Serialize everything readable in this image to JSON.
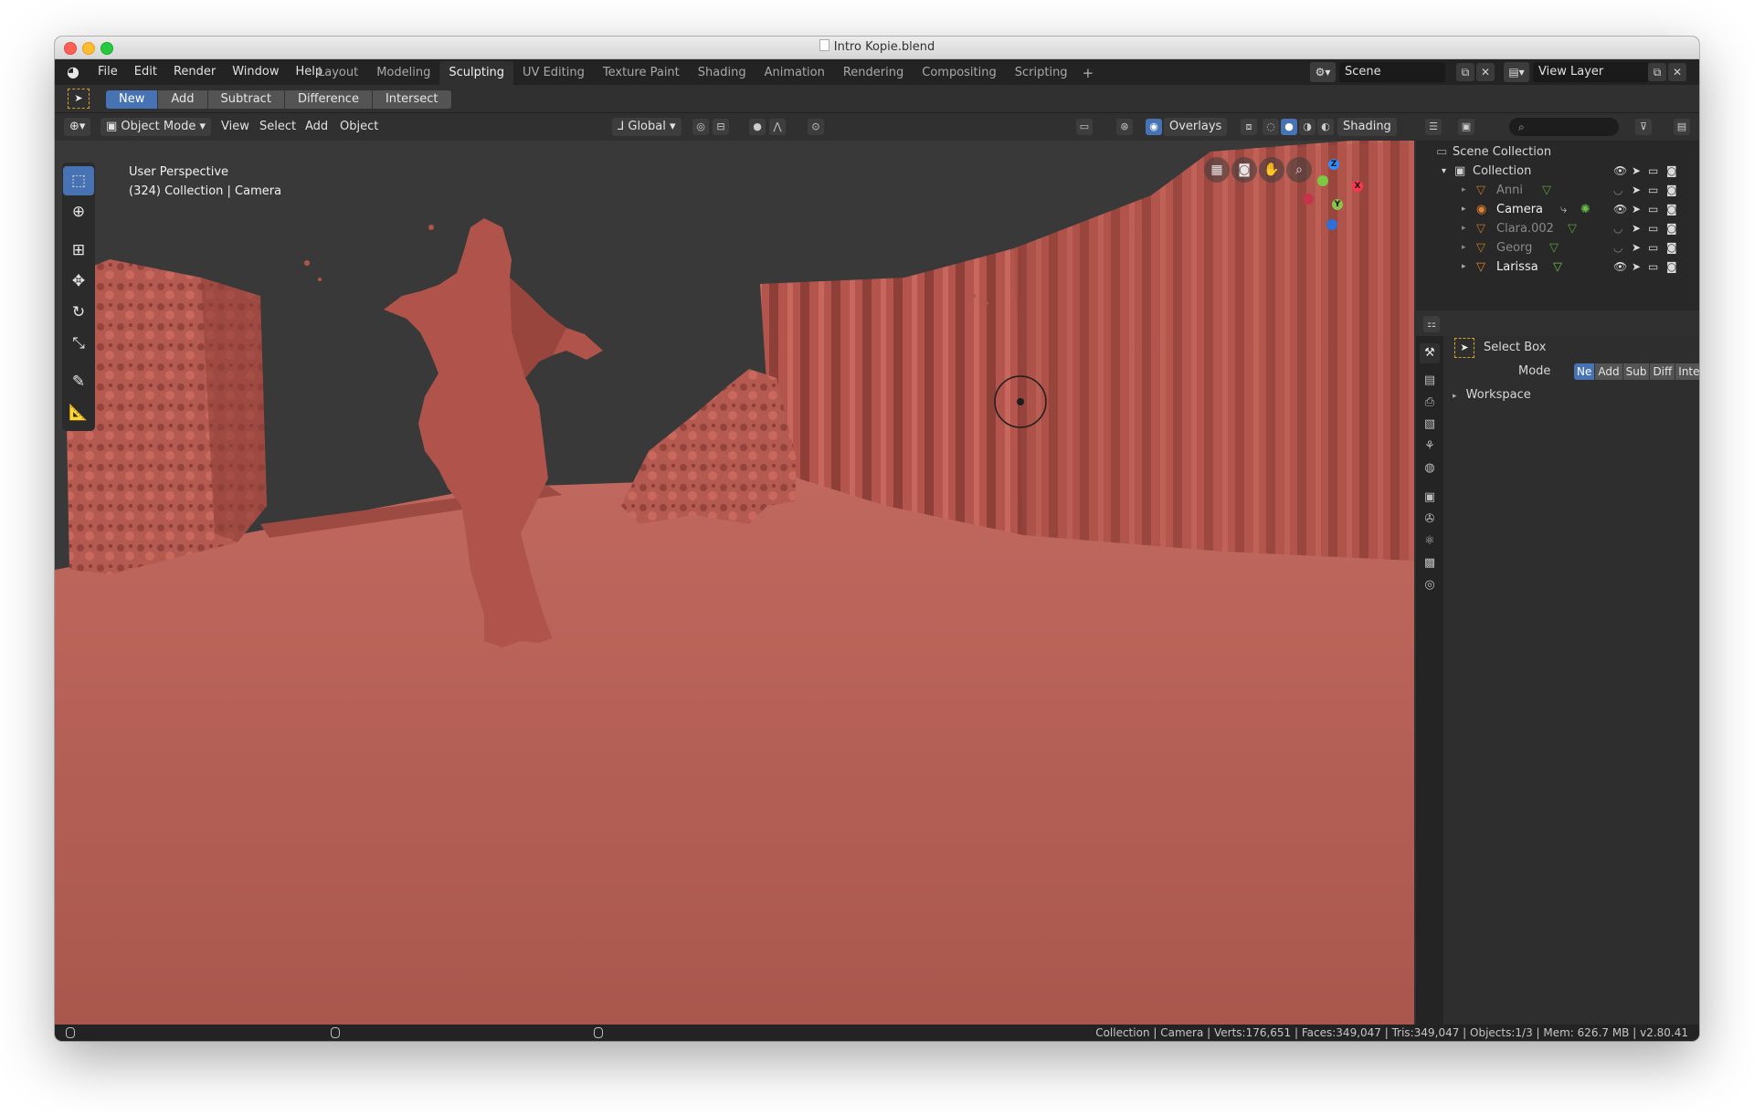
{
  "window": {
    "title": "Intro Kopie.blend"
  },
  "menu": [
    "File",
    "Edit",
    "Render",
    "Window",
    "Help"
  ],
  "workspaces": [
    "Layout",
    "Modeling",
    "Sculpting",
    "UV Editing",
    "Texture Paint",
    "Shading",
    "Animation",
    "Rendering",
    "Compositing",
    "Scripting"
  ],
  "active_workspace": "Sculpting",
  "scene": {
    "name": "Scene",
    "view_layer": "View Layer"
  },
  "tool_settings": {
    "modes": [
      "New",
      "Add",
      "Subtract",
      "Difference",
      "Intersect"
    ],
    "active": "New"
  },
  "viewport_header": {
    "mode": "Object Mode",
    "menus": [
      "View",
      "Select",
      "Add",
      "Object"
    ],
    "orientation": "Global",
    "overlays": "Overlays",
    "shading": "Shading"
  },
  "viewport": {
    "perspective": "User Perspective",
    "collection_info": "(324) Collection | Camera",
    "axes": [
      "X",
      "Y",
      "Z"
    ],
    "mesh_color": "#b4574e"
  },
  "outliner": {
    "root": "Scene Collection",
    "collection": "Collection",
    "items": [
      {
        "name": "Anni",
        "visible": false
      },
      {
        "name": "Camera",
        "visible": true
      },
      {
        "name": "Clara.002",
        "visible": false
      },
      {
        "name": "Georg",
        "visible": false
      },
      {
        "name": "Larissa",
        "visible": true
      }
    ]
  },
  "properties": {
    "tool": "Select Box",
    "mode_label": "Mode",
    "modes": [
      "Ne",
      "Add",
      "Sub",
      "Diff",
      "Inte"
    ],
    "panel": "Workspace"
  },
  "status": {
    "text": "Collection | Camera | Verts:176,651 | Faces:349,047 | Tris:349,047 | Objects:1/3 | Mem: 626.7 MB | v2.80.41"
  },
  "colors": {
    "accent": "#4772b3",
    "tool_outline": "#d9a12e",
    "object_orange": "#e0822c",
    "mesh_green": "#6cc04a"
  }
}
